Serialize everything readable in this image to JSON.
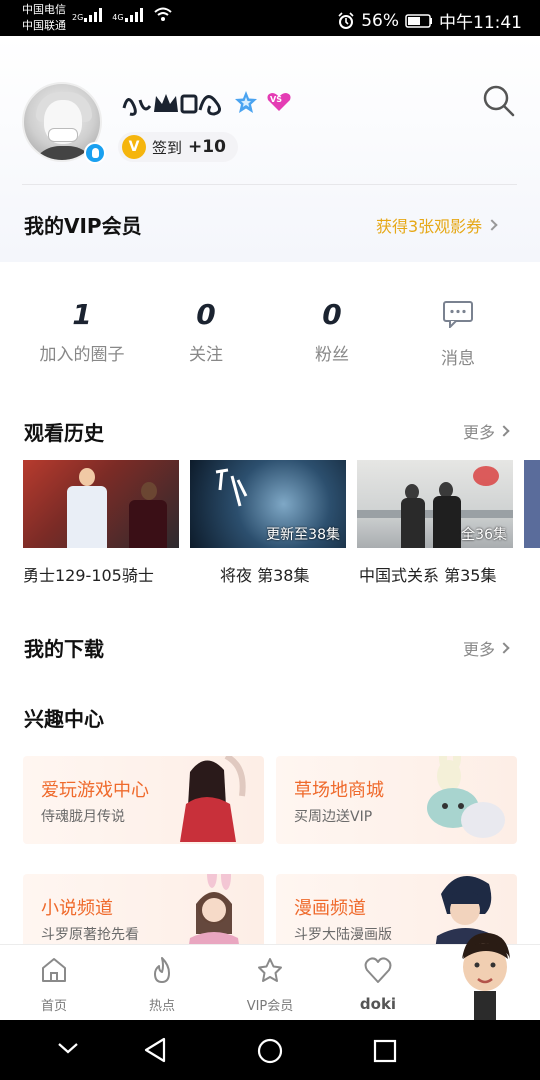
{
  "status_bar": {
    "carrier1": "中国电信",
    "carrier2": "中国联通",
    "net1": "2G",
    "net2": "4G",
    "battery": "56%",
    "time": "中午11:41"
  },
  "profile": {
    "check_in_badge": "V",
    "check_in_label": "签到",
    "check_in_points": "+10",
    "vip_badge": "VS"
  },
  "vip": {
    "title": "我的VIP会员",
    "link": "获得3张观影券"
  },
  "stats": [
    {
      "value": "1",
      "label": "加入的圈子"
    },
    {
      "value": "0",
      "label": "关注"
    },
    {
      "value": "0",
      "label": "粉丝"
    },
    {
      "value": "",
      "label": "消息"
    }
  ],
  "history": {
    "title": "观看历史",
    "more": "更多",
    "items": [
      {
        "caption": "勇士129-105骑士",
        "tag": ""
      },
      {
        "caption": "将夜 第38集",
        "tag": "更新至38集"
      },
      {
        "caption": "中国式关系 第35集",
        "tag": "全36集"
      }
    ]
  },
  "downloads": {
    "title": "我的下载",
    "more": "更多"
  },
  "interest": {
    "title": "兴趣中心",
    "cards": [
      {
        "title": "爱玩游戏中心",
        "sub": "侍魂胧月传说"
      },
      {
        "title": "草场地商城",
        "sub": "买周边送VIP"
      },
      {
        "title": "小说频道",
        "sub": "斗罗原著抢先看"
      },
      {
        "title": "漫画频道",
        "sub": "斗罗大陆漫画版"
      }
    ]
  },
  "tabbar": [
    {
      "label": "首页"
    },
    {
      "label": "热点"
    },
    {
      "label": "VIP会员"
    },
    {
      "label": "doki"
    }
  ],
  "colors": {
    "accent_orange": "#ef6a2c",
    "vip_gold": "#e6a817",
    "badge_blue": "#1aa0f0"
  }
}
